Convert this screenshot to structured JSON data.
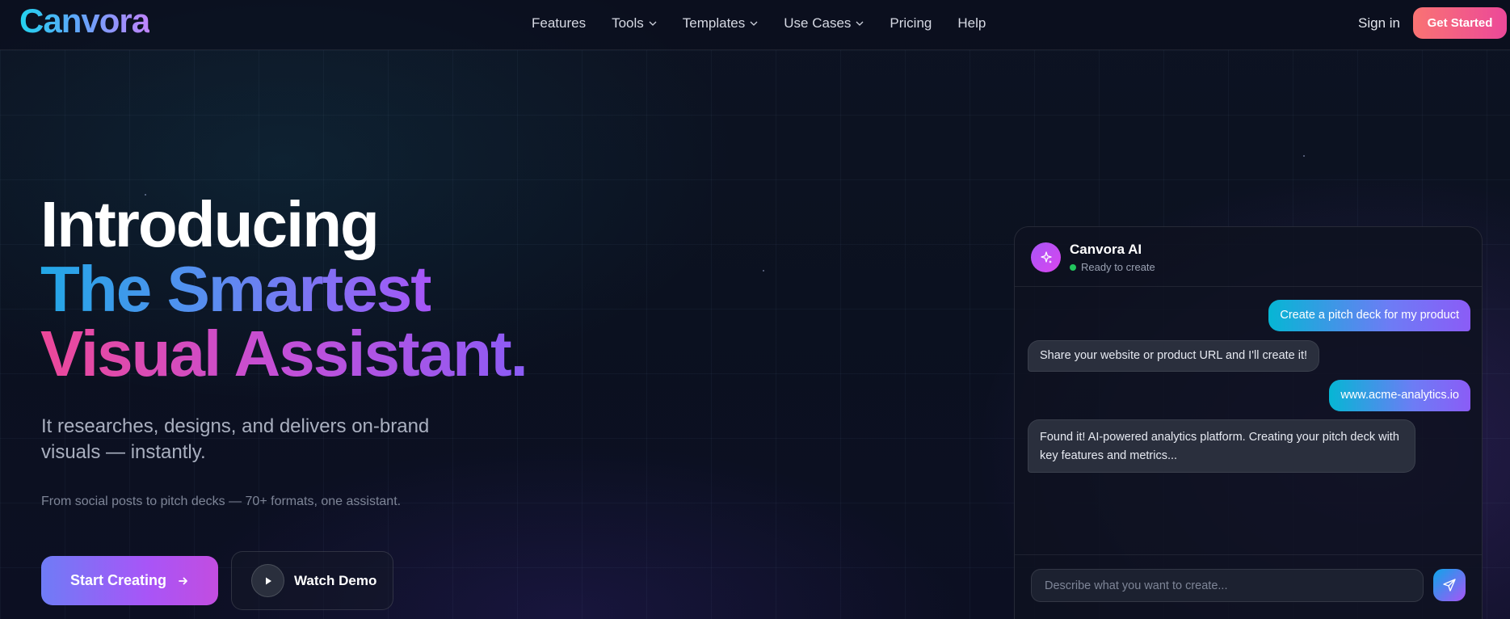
{
  "nav": {
    "logo": "Canvora",
    "links": [
      {
        "label": "Features",
        "dropdown": false
      },
      {
        "label": "Tools",
        "dropdown": true
      },
      {
        "label": "Templates",
        "dropdown": true
      },
      {
        "label": "Use Cases",
        "dropdown": true
      },
      {
        "label": "Pricing",
        "dropdown": false
      },
      {
        "label": "Help",
        "dropdown": false
      }
    ],
    "signin": "Sign in",
    "cta": "Get Started"
  },
  "hero": {
    "line1": "Introducing",
    "line2": "The Smartest",
    "line3": "Visual Assistant.",
    "subtitle": "It researches, designs, and delivers on-brand visuals — instantly.",
    "note": "From social posts to pitch decks — 70+ formats, one assistant.",
    "primary_button": "Start Creating",
    "secondary_button": "Watch Demo"
  },
  "chat": {
    "name": "Canvora AI",
    "status": "Ready to create",
    "messages": [
      {
        "role": "user",
        "text": "Create a pitch deck for my product"
      },
      {
        "role": "bot",
        "text": "Share your website or product URL and I'll create it!"
      },
      {
        "role": "user",
        "text": "www.acme-analytics.io"
      },
      {
        "role": "bot",
        "text": "Found it! AI-powered analytics platform. Creating your pitch deck with key features and metrics..."
      }
    ],
    "input_placeholder": "Describe what you want to create..."
  },
  "colors": {
    "background": "#0b1020",
    "accent_cyan": "#22d3ee",
    "accent_purple": "#a855f7",
    "accent_pink": "#ec4899",
    "status_online": "#22c55e"
  },
  "icons": [
    "chevron-down-icon",
    "arrow-right-icon",
    "play-icon",
    "sparkles-icon",
    "send-icon"
  ]
}
